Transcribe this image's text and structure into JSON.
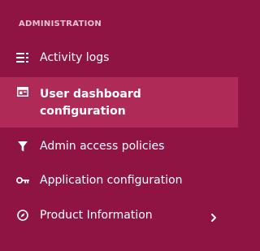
{
  "sidebar": {
    "section_heading": "ADMINISTRATION",
    "items": [
      {
        "label": "Activity logs",
        "icon": "list-icon",
        "active": false
      },
      {
        "label": "User dashboard configuration",
        "icon": "dashboard-icon",
        "active": true
      },
      {
        "label": "Admin access policies",
        "icon": "filter-icon",
        "active": false
      },
      {
        "label": "Application configuration",
        "icon": "key-icon",
        "active": false
      },
      {
        "label": "Product Information",
        "icon": "compass-icon",
        "active": false,
        "has_submenu": true
      }
    ]
  },
  "colors": {
    "background": "#8f1444",
    "active_background": "#b02a58",
    "heading_text": "#e9c2d2",
    "text": "#ffffff"
  }
}
